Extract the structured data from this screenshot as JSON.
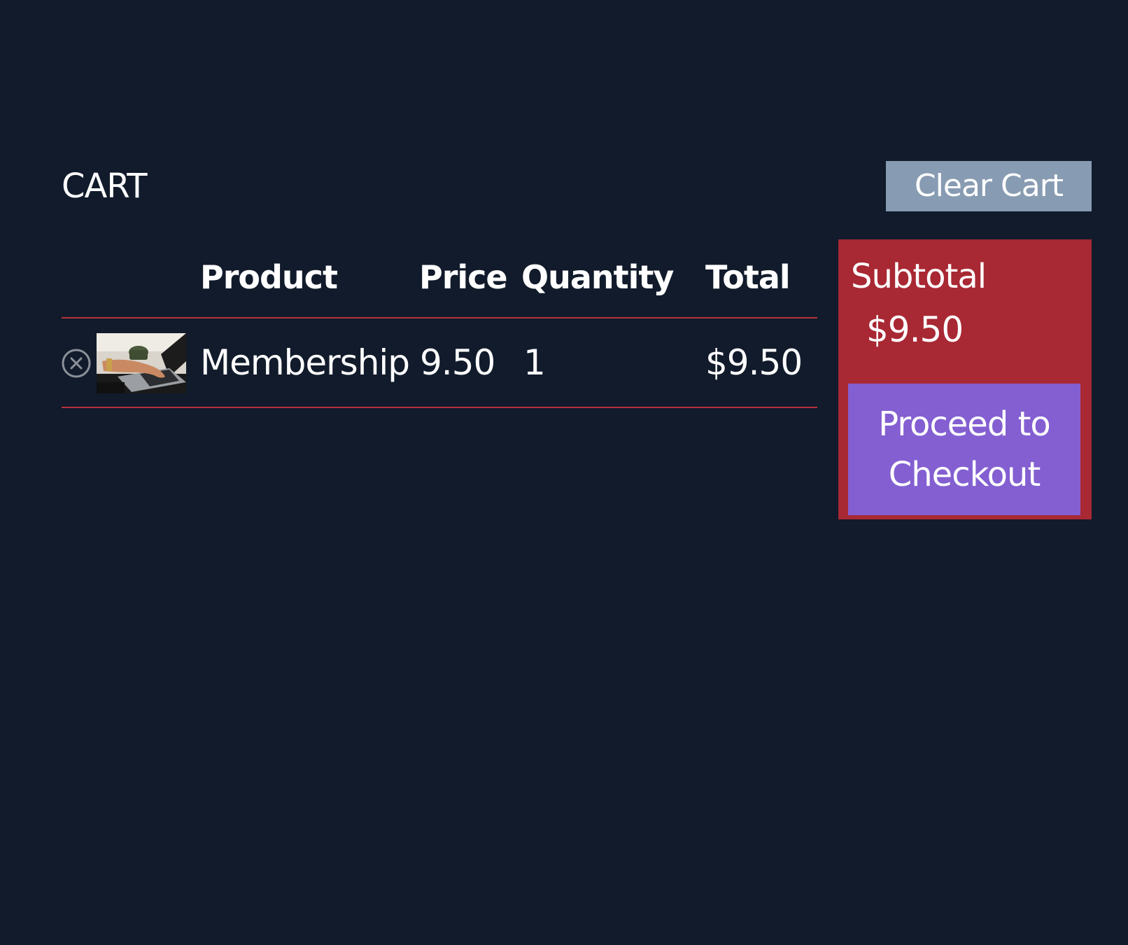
{
  "header": {
    "title": "CART",
    "clear_cart_label": "Clear Cart"
  },
  "table": {
    "columns": {
      "product": "Product",
      "price": "Price",
      "quantity": "Quantity",
      "total": "Total"
    },
    "rows": [
      {
        "remove_icon": "circle-x-icon",
        "thumbnail": "laptop-typing-photo",
        "product": "Membership",
        "price": "9.50",
        "quantity": "1",
        "total": "$9.50"
      }
    ]
  },
  "summary": {
    "subtotal_label": "Subtotal",
    "subtotal_value": "$9.50",
    "checkout_label": "Proceed to Checkout"
  },
  "colors": {
    "background": "#111b2b",
    "clear_cart_bg": "#879bb2",
    "accent_red": "#a82833",
    "divider": "#b7323b",
    "checkout_bg": "#835fd1",
    "text": "#ffffff"
  }
}
